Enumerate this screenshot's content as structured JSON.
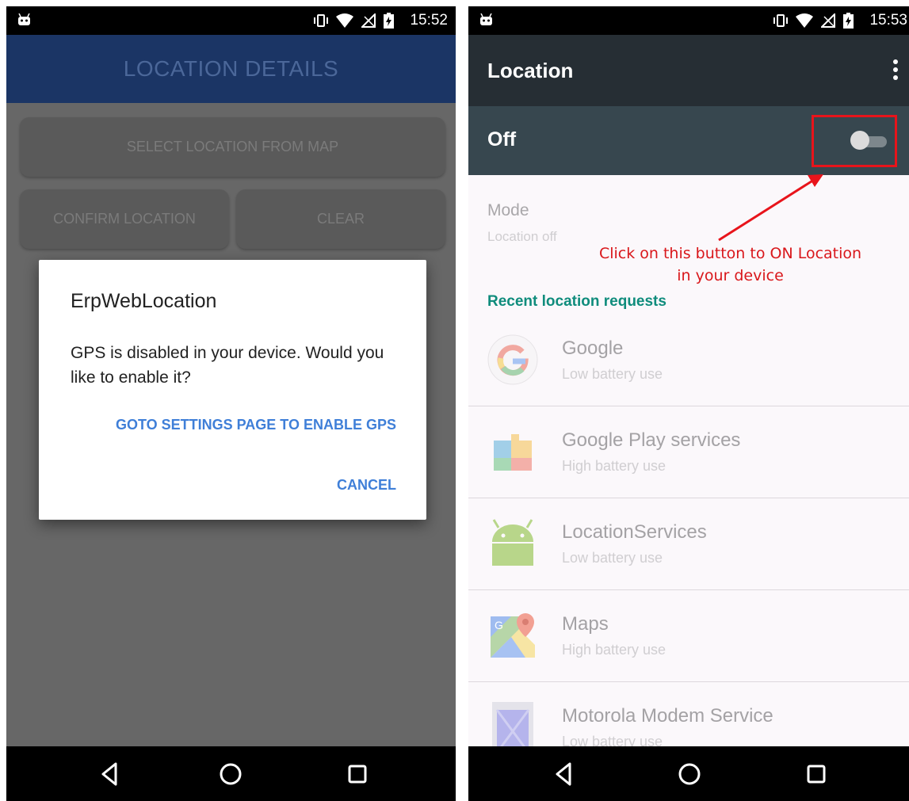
{
  "left": {
    "status": {
      "time": "15:52"
    },
    "appbar": {
      "title": "LOCATION DETAILS"
    },
    "buttons": {
      "select_map": "SELECT LOCATION FROM MAP",
      "confirm": "CONFIRM LOCATION",
      "clear": "CLEAR"
    },
    "dialog": {
      "title": "ErpWebLocation",
      "message": "GPS is disabled in your device. Would you like to enable it?",
      "goto_settings": "GOTO SETTINGS PAGE TO ENABLE GPS",
      "cancel": "CANCEL"
    },
    "nav": {
      "back": "back-icon",
      "home": "home-icon",
      "recents": "recents-icon"
    }
  },
  "right": {
    "status": {
      "time": "15:53"
    },
    "toolbar": {
      "title": "Location"
    },
    "switchbar": {
      "label": "Off",
      "state": "off"
    },
    "mode": {
      "label": "Mode",
      "value": "Location off"
    },
    "annotation": {
      "line1": "Click on this button to ON Location",
      "line2": "in your device"
    },
    "section_title": "Recent location requests",
    "apps": [
      {
        "name": "Google",
        "usage": "Low battery use"
      },
      {
        "name": "Google Play services",
        "usage": "High battery use"
      },
      {
        "name": "LocationServices",
        "usage": "Low battery use"
      },
      {
        "name": "Maps",
        "usage": "High battery use"
      },
      {
        "name": "Motorola Modem Service",
        "usage": "Low battery use"
      }
    ]
  },
  "colors": {
    "appbar": "#1b3565",
    "dialog_action": "#3f7fd8",
    "settings_toolbar": "#262e34",
    "switch_bar": "#37474f",
    "section_title": "#0f8c7c",
    "annotation": "#d9171b"
  }
}
